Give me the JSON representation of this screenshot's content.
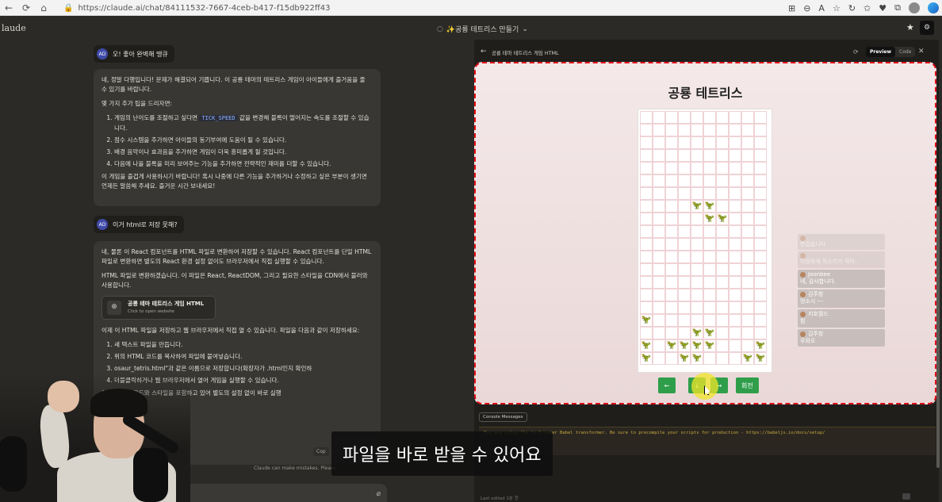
{
  "browser": {
    "url": "https://claude.ai/chat/84111532-7667-4ceb-b417-f15db922ff43",
    "nav_icons": [
      "←",
      "⟳",
      "⌂"
    ],
    "right_icons": [
      "⊞",
      "⊖",
      "A",
      "☆",
      "↻",
      "✩",
      "♥",
      "⧉"
    ]
  },
  "app": {
    "brand": "laude",
    "chat_title": "✨공룡 테트리스 만들기",
    "chat_title_chevron": "⌄",
    "chat_icon": "◌"
  },
  "chat": {
    "user_avatar": "AD",
    "msg1_user": "오! 좋아 완벽해 땡큐",
    "msg1_ai": {
      "p1": "네, 정말 다행입니다! 문제가 해결되어 기쁩니다. 이 공룡 테마의 테트리스 게임이 아이들에게 즐거움을 줄 수 있기를 바랍니다.",
      "p2": "몇 가지 추가 팁을 드리자면:",
      "tips": [
        {
          "pre": "게임의 난이도를 조절하고 싶다면 ",
          "code": "TICK_SPEED",
          "post": " 값을 변경해 블록이 떨어지는 속도를 조절할 수 있습니다."
        },
        {
          "pre": "점수 시스템을 추가하면 아이들의 동기부여에 도움이 될 수 있습니다.",
          "code": "",
          "post": ""
        },
        {
          "pre": "배경 음악이나 효과음을 추가하면 게임이 더욱 흥미롭게 될 것입니다.",
          "code": "",
          "post": ""
        },
        {
          "pre": "다음에 나올 블록을 미리 보여주는 기능을 추가하면 전략적인 재미를 더할 수 있습니다.",
          "code": "",
          "post": ""
        }
      ],
      "p3": "이 게임을 즐겁게 사용하시기 바랍니다! 혹시 나중에 다른 기능을 추가하거나 수정하고 싶은 부분이 생기면 언제든 말씀해 주세요. 즐거운 시간 보내세요!"
    },
    "msg2_user": "이거 html로 저장 못해?",
    "msg2_ai": {
      "p1": "네, 물론 이 React 컴포넌트를 HTML 파일로 변환하여 저장할 수 있습니다. React 컴포넌트를 단일 HTML 파일로 변환하면 별도의 React 환경 설정 없이도 브라우저에서 직접 실행할 수 있습니다.",
      "p2": "HTML 파일로 변환하겠습니다. 이 파일은 React, ReactDOM, 그리고 필요한 스타일을 CDN에서 불러와 사용합니다.",
      "artifact_title": "공룡 테마 테트리스 게임 HTML",
      "artifact_sub": "Click to open website",
      "artifact_icon": "⊕",
      "p3": "이제 이 HTML 파일을 저장하고 웹 브라우저에서 직접 열 수 있습니다. 파일을 다음과 같이 저장하세요:",
      "steps": [
        "새 텍스트 파일을 만듭니다.",
        "위의 HTML 코드를 복사하여 파일에 붙여넣습니다.",
        "osaur_tetris.html\"과 같은 이름으로 저장합니다(확장자가 .html인지 확인하",
        "더블클릭하거나 웹 브라우저에서 열어 게임을 실행할 수 있습니다."
      ],
      "p4": "모든 필요한 코드와 스타일을 포함하고 있어 별도의 설정 없이 바로 실행",
      "p5": "거운 게임 되세요!"
    },
    "copy_label": "Cop",
    "disclaimer": "Claude can make mistakes. Please",
    "attach_icon": "⌀"
  },
  "panel": {
    "back": "←",
    "title": "공룡 테마 테트리스 게임 HTML",
    "refresh": "⟳",
    "tab_preview": "Preview",
    "tab_code": "Code",
    "close": "✕"
  },
  "game": {
    "title": "공룡 테트리스",
    "dino_glyph": "🦖",
    "grid_cols": 10,
    "grid_rows": 20,
    "filled_cells": [
      [
        7,
        4
      ],
      [
        7,
        5
      ],
      [
        8,
        5
      ],
      [
        8,
        6
      ],
      [
        16,
        0
      ],
      [
        17,
        4
      ],
      [
        17,
        5
      ],
      [
        18,
        0
      ],
      [
        18,
        2
      ],
      [
        18,
        3
      ],
      [
        18,
        4
      ],
      [
        18,
        5
      ],
      [
        18,
        9
      ],
      [
        19,
        0
      ],
      [
        19,
        3
      ],
      [
        19,
        4
      ],
      [
        19,
        8
      ],
      [
        19,
        9
      ]
    ],
    "buttons": {
      "left": "←",
      "down": "↓",
      "right": "→",
      "rotate": "회전"
    }
  },
  "live_chat": [
    {
      "name": "",
      "text": "반갑습니다",
      "faded": true
    },
    {
      "name": "",
      "text": "이상하게 목소리가 작아..",
      "faded": true
    },
    {
      "name": "Joonbee",
      "text": "네, 감사합니다.",
      "faded": false
    },
    {
      "name": "김주창",
      "text": "멍소시 ‑‑‑",
      "faded": false
    },
    {
      "name": "지호월드",
      "text": "힘",
      "faded": false
    },
    {
      "name": "김주창",
      "text": "우와오",
      "faded": false
    }
  ],
  "console": {
    "tab": "Console Messages",
    "warning": "You are using the in-browser Babel transformer. Be sure to precompile your scripts for production - https://babeljs.io/docs/setup/",
    "footer": "Last edited 1분 전"
  },
  "subtitle": "파일을 바로 받을 수 있어요"
}
